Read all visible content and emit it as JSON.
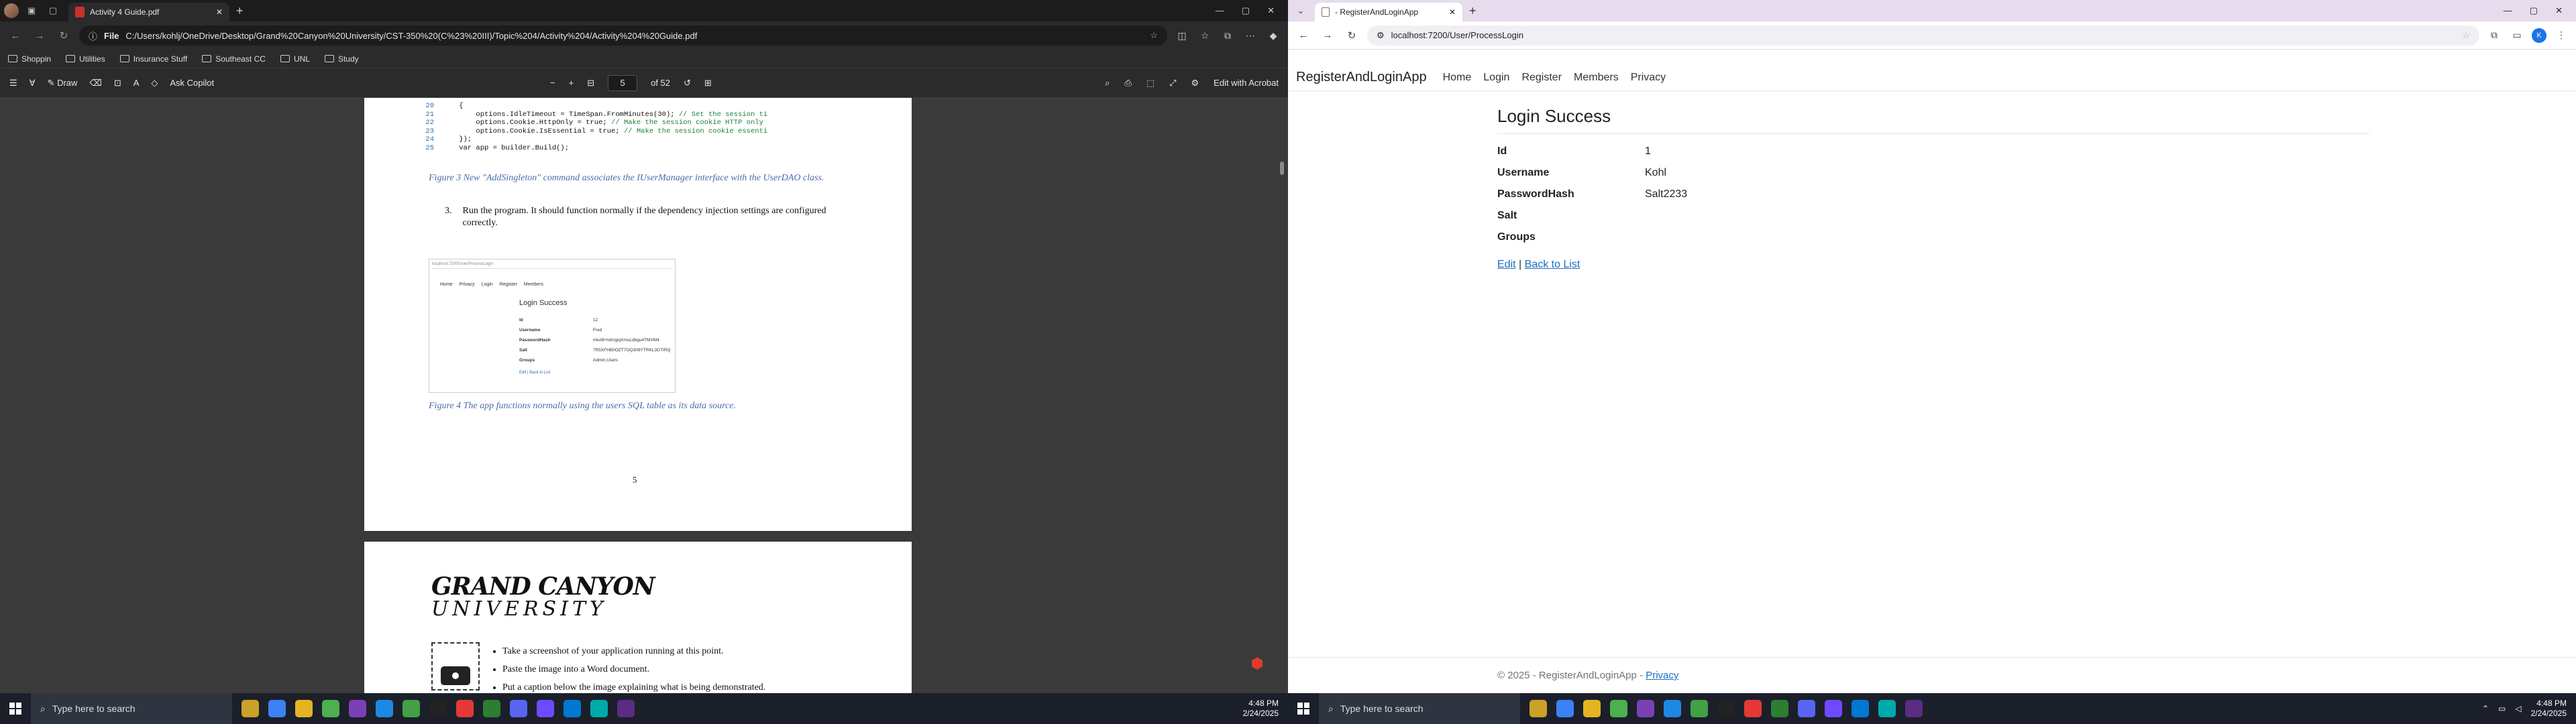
{
  "left_browser": {
    "tab_title": "Activity 4 Guide.pdf",
    "address_chip": "File",
    "url": "C:/Users/kohlj/OneDrive/Desktop/Grand%20Canyon%20University/CST-350%20(C%23%20III)/Topic%204/Activity%204/Activity%204%20Guide.pdf",
    "bookmarks": [
      "Shoppin",
      "Utilities",
      "Insurance Stuff",
      "Southeast CC",
      "UNL",
      "Study"
    ],
    "pdf_toolbar": {
      "draw_label": "Draw",
      "ask_copilot_label": "Ask Copilot",
      "page_current": "5",
      "page_total": "of 52",
      "edit_acrobat_label": "Edit with Acrobat"
    }
  },
  "pdf_page5": {
    "code_lines": [
      {
        "num": "20",
        "text": "    {",
        "comment": ""
      },
      {
        "num": "21",
        "text": "        options.IdleTimeout = TimeSpan.FromMinutes(30); ",
        "comment": "// Set the session ti"
      },
      {
        "num": "22",
        "text": "        options.Cookie.HttpOnly = true; ",
        "comment": "// Make the session cookie HTTP only"
      },
      {
        "num": "23",
        "text": "        options.Cookie.IsEssential = true; ",
        "comment": "// Make the session cookie essenti"
      },
      {
        "num": "24",
        "text": "    });",
        "comment": ""
      },
      {
        "num": "25",
        "text": "    var app = builder.Build();",
        "comment": ""
      }
    ],
    "figure3_caption": "Figure 3 New \"AddSingleton\" command associates the IUserManager interface with the UserDAO class.",
    "step3_num": "3.",
    "step3_text": "Run the program.  It should function normally if the dependency injection settings are configured correctly.",
    "thumb": {
      "url": "localhost:7200/User/ProcessLogin",
      "nav": [
        "Home",
        "Privacy",
        "Login",
        "Register",
        "Members"
      ],
      "title": "Login Success",
      "rows": [
        {
          "k": "Id",
          "v": "12"
        },
        {
          "k": "Username",
          "v": "Fred"
        },
        {
          "k": "PasswordHash",
          "v": "mkAB+lolUgiqXmuLdbgu4TMVM4"
        },
        {
          "k": "Salt",
          "v": "7R5XFHB0OZT7OQ309YTRKL3GTIRQ"
        },
        {
          "k": "Groups",
          "v": "Admin,Users"
        }
      ],
      "links": "Edit | Back to List"
    },
    "figure4_caption": "Figure 4 The app functions normally using the users SQL table as its data source.",
    "page_number": "5"
  },
  "pdf_page6": {
    "logo_line1": "GRAND CANYON",
    "logo_line2": "UNIVERSITY",
    "bullets": [
      "Take a screenshot of your application running at this point.",
      "Paste the image into a Word document.",
      "Put a caption below the image explaining what is being demonstrated."
    ]
  },
  "right_browser": {
    "tab_title": "- RegisterAndLoginApp",
    "url": "localhost:7200/User/ProcessLogin",
    "profile_letter": "K"
  },
  "webapp": {
    "brand": "RegisterAndLoginApp",
    "nav": [
      "Home",
      "Login",
      "Register",
      "Members",
      "Privacy"
    ],
    "heading": "Login Success",
    "fields": [
      {
        "label": "Id",
        "value": "1"
      },
      {
        "label": "Username",
        "value": "Kohl"
      },
      {
        "label": "PasswordHash",
        "value": "Salt2233"
      },
      {
        "label": "Salt",
        "value": ""
      },
      {
        "label": "Groups",
        "value": ""
      }
    ],
    "edit_link": "Edit",
    "separator": "|",
    "back_link": "Back to List",
    "footer_text": "© 2025 - RegisterAndLoginApp - ",
    "footer_link": "Privacy"
  },
  "taskbar": {
    "search_placeholder": "Type here to search",
    "time": "4:48 PM",
    "date": "2/24/2025"
  },
  "colors": {
    "link": "#1b6ec2",
    "pdf_caption": "#4a6da7",
    "taskbar": "#1b1f2a"
  }
}
